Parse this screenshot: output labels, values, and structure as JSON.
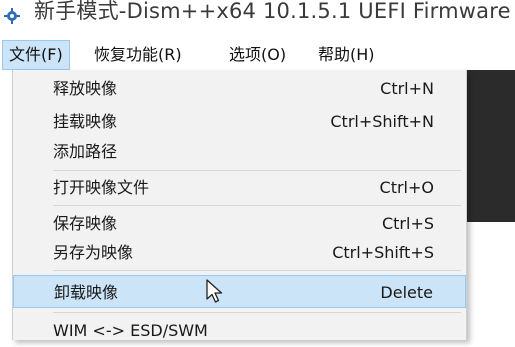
{
  "window": {
    "title": "新手模式-Dism++x64 10.1.5.1 UEFI Firmware"
  },
  "menubar": {
    "items": [
      {
        "label": "文件(F)"
      },
      {
        "label": "恢复功能(R)"
      },
      {
        "label": "选项(O)"
      },
      {
        "label": "帮助(H)"
      }
    ]
  },
  "file_menu": {
    "items": [
      {
        "label": "释放映像",
        "shortcut": "Ctrl+N"
      },
      {
        "label": "挂载映像",
        "shortcut": "Ctrl+Shift+N"
      },
      {
        "label": "添加路径",
        "shortcut": ""
      },
      {
        "label": "打开映像文件",
        "shortcut": "Ctrl+O"
      },
      {
        "label": "保存映像",
        "shortcut": "Ctrl+S"
      },
      {
        "label": "另存为映像",
        "shortcut": "Ctrl+Shift+S"
      },
      {
        "label": "卸载映像",
        "shortcut": "Delete"
      },
      {
        "label": "WIM <-> ESD/SWM",
        "shortcut": ""
      }
    ],
    "highlighted_item": "卸载映像"
  },
  "icons": {
    "app": "dism-gear-icon",
    "cursor": "mouse-pointer-icon"
  },
  "colors": {
    "highlight_bg": "#cce4f7",
    "highlight_border": "#99c9ef",
    "menu_bg": "#f2f2f2",
    "dark_panel": "#2b2b2b"
  }
}
